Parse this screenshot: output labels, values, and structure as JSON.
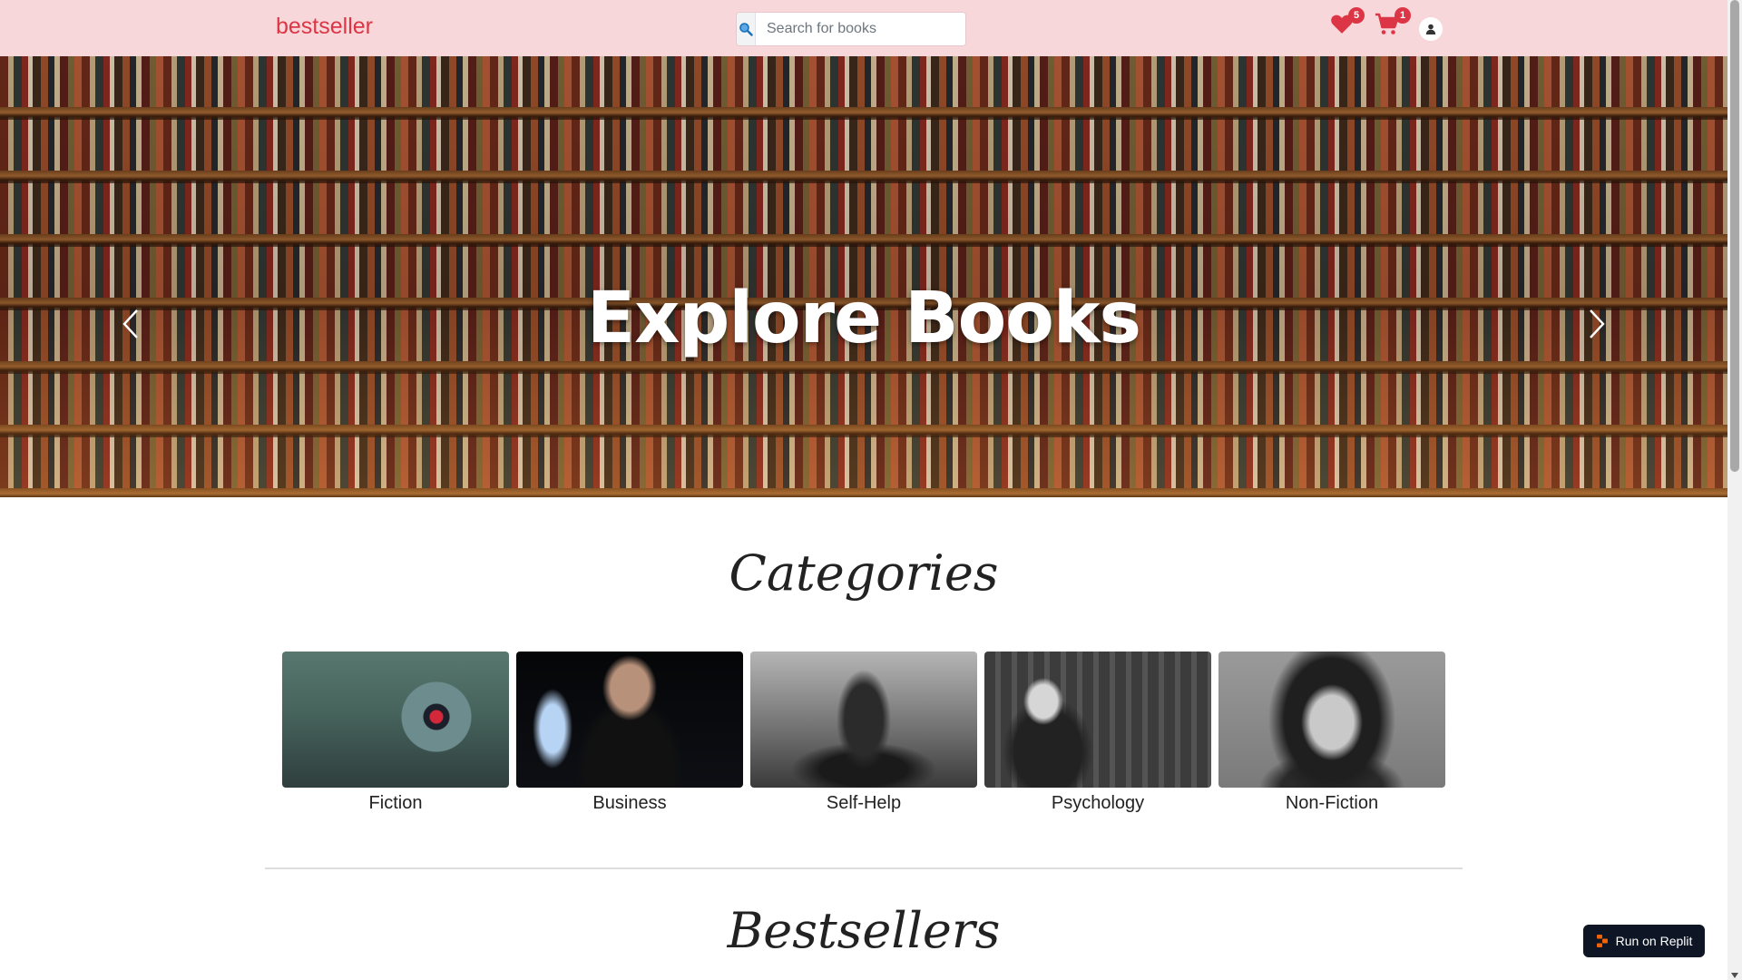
{
  "navbar": {
    "brand": "bestseller",
    "search": {
      "placeholder": "Search for books",
      "value": ""
    },
    "wishlist": {
      "icon": "heart-icon",
      "count": "5"
    },
    "cart": {
      "icon": "cart-icon",
      "count": "1"
    },
    "profile": {
      "icon": "user-icon"
    }
  },
  "hero": {
    "title": "Explore Books",
    "prev_icon": "chevron-left-icon",
    "next_icon": "chevron-right-icon"
  },
  "categories": {
    "title": "Categories",
    "items": [
      {
        "label": "Fiction"
      },
      {
        "label": "Business"
      },
      {
        "label": "Self-Help"
      },
      {
        "label": "Psychology"
      },
      {
        "label": "Non-Fiction"
      }
    ]
  },
  "bestsellers": {
    "title": "Bestsellers"
  },
  "replit": {
    "label": "Run on Replit"
  },
  "colors": {
    "navbar_bg": "#f8d7da",
    "brand": "#dc3545",
    "badge": "#dc3545",
    "replit_bg": "#0e1525",
    "replit_logo": "#f26207"
  }
}
